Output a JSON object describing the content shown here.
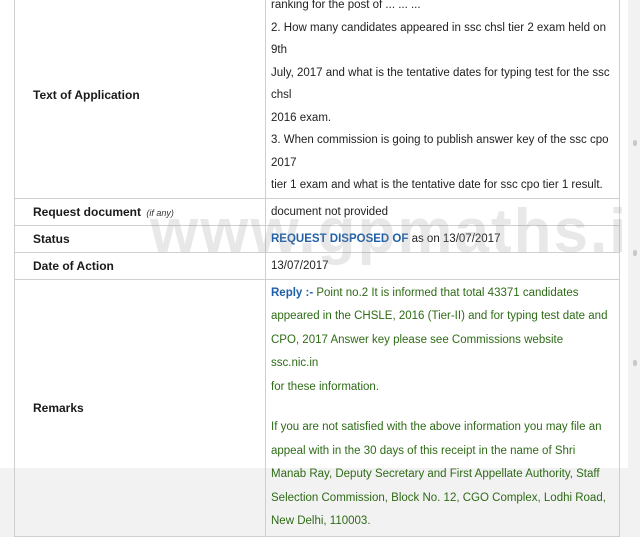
{
  "application": {
    "label": "Text of Application",
    "lines": [
      "ranking for the post of ... ... ...",
      "2. How many candidates appeared in ssc chsl tier 2 exam held on 9th",
      "July, 2017 and what is the tentative dates for typing test for the ssc chsl",
      "2016 exam.",
      "3. When commission is going to publish answer key of the ssc cpo 2017",
      "tier 1 exam and what is the tentative date for ssc cpo tier 1 result."
    ]
  },
  "request_document": {
    "label": "Request document",
    "note": "(if any)",
    "value": "document not provided"
  },
  "status": {
    "label": "Status",
    "link": "REQUEST DISPOSED OF",
    "suffix": " as on 13/07/2017"
  },
  "date_of_action": {
    "label": "Date of Action",
    "value": "13/07/2017"
  },
  "remarks": {
    "label": "Remarks",
    "reply_label": "Reply :-",
    "reply_lines": [
      " Point no.2 It is informed that total 43371 candidates",
      "appeared in the CHSLE, 2016 (Tier-II) and for typing test date and",
      "CPO, 2017 Answer key please see Commissions website ssc.nic.in",
      "for these information."
    ],
    "appeal_lines": [
      "If you are not satisfied with the above information you may file an",
      "appeal with in the 30 days of this receipt in the name of Shri",
      "Manab Ray, Deputy Secretary and First Appellate Authority, Staff",
      "Selection Commission, Block No. 12, CGO Complex, Lodhi Road,",
      "New Delhi, 110003."
    ]
  },
  "watermark": "www.gpmaths.in"
}
